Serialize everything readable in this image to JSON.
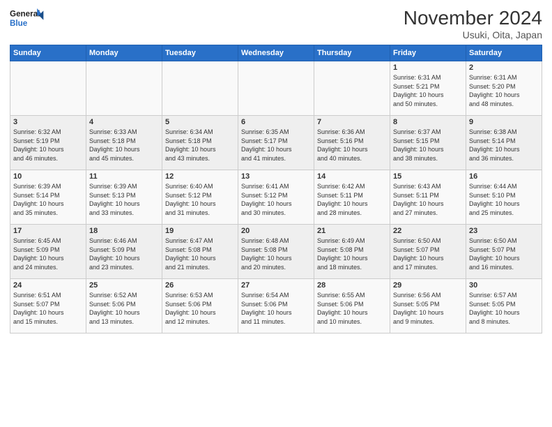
{
  "header": {
    "logo_line1": "General",
    "logo_line2": "Blue",
    "title": "November 2024",
    "subtitle": "Usuki, Oita, Japan"
  },
  "weekdays": [
    "Sunday",
    "Monday",
    "Tuesday",
    "Wednesday",
    "Thursday",
    "Friday",
    "Saturday"
  ],
  "weeks": [
    [
      {
        "day": "",
        "info": ""
      },
      {
        "day": "",
        "info": ""
      },
      {
        "day": "",
        "info": ""
      },
      {
        "day": "",
        "info": ""
      },
      {
        "day": "",
        "info": ""
      },
      {
        "day": "1",
        "info": "Sunrise: 6:31 AM\nSunset: 5:21 PM\nDaylight: 10 hours\nand 50 minutes."
      },
      {
        "day": "2",
        "info": "Sunrise: 6:31 AM\nSunset: 5:20 PM\nDaylight: 10 hours\nand 48 minutes."
      }
    ],
    [
      {
        "day": "3",
        "info": "Sunrise: 6:32 AM\nSunset: 5:19 PM\nDaylight: 10 hours\nand 46 minutes."
      },
      {
        "day": "4",
        "info": "Sunrise: 6:33 AM\nSunset: 5:18 PM\nDaylight: 10 hours\nand 45 minutes."
      },
      {
        "day": "5",
        "info": "Sunrise: 6:34 AM\nSunset: 5:18 PM\nDaylight: 10 hours\nand 43 minutes."
      },
      {
        "day": "6",
        "info": "Sunrise: 6:35 AM\nSunset: 5:17 PM\nDaylight: 10 hours\nand 41 minutes."
      },
      {
        "day": "7",
        "info": "Sunrise: 6:36 AM\nSunset: 5:16 PM\nDaylight: 10 hours\nand 40 minutes."
      },
      {
        "day": "8",
        "info": "Sunrise: 6:37 AM\nSunset: 5:15 PM\nDaylight: 10 hours\nand 38 minutes."
      },
      {
        "day": "9",
        "info": "Sunrise: 6:38 AM\nSunset: 5:14 PM\nDaylight: 10 hours\nand 36 minutes."
      }
    ],
    [
      {
        "day": "10",
        "info": "Sunrise: 6:39 AM\nSunset: 5:14 PM\nDaylight: 10 hours\nand 35 minutes."
      },
      {
        "day": "11",
        "info": "Sunrise: 6:39 AM\nSunset: 5:13 PM\nDaylight: 10 hours\nand 33 minutes."
      },
      {
        "day": "12",
        "info": "Sunrise: 6:40 AM\nSunset: 5:12 PM\nDaylight: 10 hours\nand 31 minutes."
      },
      {
        "day": "13",
        "info": "Sunrise: 6:41 AM\nSunset: 5:12 PM\nDaylight: 10 hours\nand 30 minutes."
      },
      {
        "day": "14",
        "info": "Sunrise: 6:42 AM\nSunset: 5:11 PM\nDaylight: 10 hours\nand 28 minutes."
      },
      {
        "day": "15",
        "info": "Sunrise: 6:43 AM\nSunset: 5:11 PM\nDaylight: 10 hours\nand 27 minutes."
      },
      {
        "day": "16",
        "info": "Sunrise: 6:44 AM\nSunset: 5:10 PM\nDaylight: 10 hours\nand 25 minutes."
      }
    ],
    [
      {
        "day": "17",
        "info": "Sunrise: 6:45 AM\nSunset: 5:09 PM\nDaylight: 10 hours\nand 24 minutes."
      },
      {
        "day": "18",
        "info": "Sunrise: 6:46 AM\nSunset: 5:09 PM\nDaylight: 10 hours\nand 23 minutes."
      },
      {
        "day": "19",
        "info": "Sunrise: 6:47 AM\nSunset: 5:08 PM\nDaylight: 10 hours\nand 21 minutes."
      },
      {
        "day": "20",
        "info": "Sunrise: 6:48 AM\nSunset: 5:08 PM\nDaylight: 10 hours\nand 20 minutes."
      },
      {
        "day": "21",
        "info": "Sunrise: 6:49 AM\nSunset: 5:08 PM\nDaylight: 10 hours\nand 18 minutes."
      },
      {
        "day": "22",
        "info": "Sunrise: 6:50 AM\nSunset: 5:07 PM\nDaylight: 10 hours\nand 17 minutes."
      },
      {
        "day": "23",
        "info": "Sunrise: 6:50 AM\nSunset: 5:07 PM\nDaylight: 10 hours\nand 16 minutes."
      }
    ],
    [
      {
        "day": "24",
        "info": "Sunrise: 6:51 AM\nSunset: 5:07 PM\nDaylight: 10 hours\nand 15 minutes."
      },
      {
        "day": "25",
        "info": "Sunrise: 6:52 AM\nSunset: 5:06 PM\nDaylight: 10 hours\nand 13 minutes."
      },
      {
        "day": "26",
        "info": "Sunrise: 6:53 AM\nSunset: 5:06 PM\nDaylight: 10 hours\nand 12 minutes."
      },
      {
        "day": "27",
        "info": "Sunrise: 6:54 AM\nSunset: 5:06 PM\nDaylight: 10 hours\nand 11 minutes."
      },
      {
        "day": "28",
        "info": "Sunrise: 6:55 AM\nSunset: 5:06 PM\nDaylight: 10 hours\nand 10 minutes."
      },
      {
        "day": "29",
        "info": "Sunrise: 6:56 AM\nSunset: 5:05 PM\nDaylight: 10 hours\nand 9 minutes."
      },
      {
        "day": "30",
        "info": "Sunrise: 6:57 AM\nSunset: 5:05 PM\nDaylight: 10 hours\nand 8 minutes."
      }
    ]
  ]
}
